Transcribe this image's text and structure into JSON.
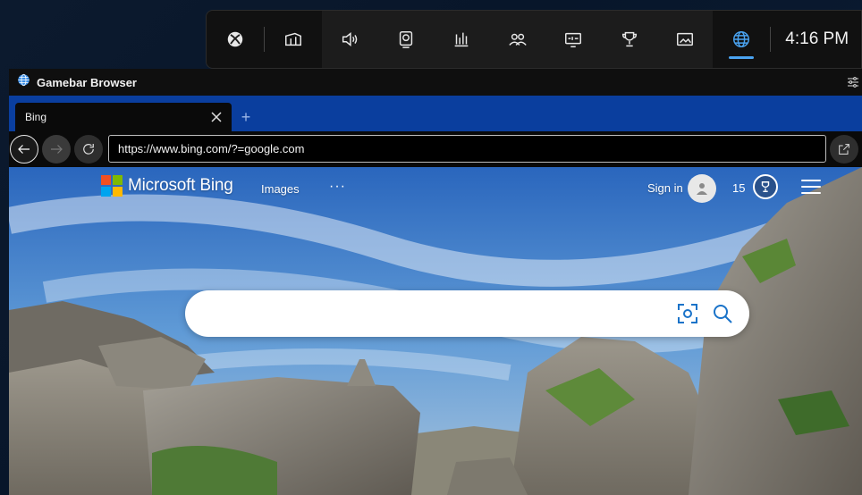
{
  "gamebar": {
    "buttons": [
      {
        "name": "xbox-icon"
      },
      {
        "name": "widget-menu-icon"
      },
      {
        "name": "audio-icon"
      },
      {
        "name": "capture-icon"
      },
      {
        "name": "performance-icon"
      },
      {
        "name": "xbox-social-icon"
      },
      {
        "name": "resources-icon"
      },
      {
        "name": "achievements-icon"
      },
      {
        "name": "gallery-icon"
      },
      {
        "name": "browser-globe-icon",
        "active": true
      }
    ],
    "clock": "4:16 PM",
    "accent": "#4aa3f0"
  },
  "window": {
    "title": "Gamebar Browser",
    "tab": {
      "label": "Bing"
    },
    "url": "https://www.bing.com/?=google.com",
    "tabstrip_color": "#0a3e9e"
  },
  "bing": {
    "brand": "Microsoft Bing",
    "images_link": "Images",
    "more": "···",
    "signin": "Sign in",
    "rewards_count": "15",
    "search_placeholder": "",
    "ms_colors": [
      "#f25022",
      "#7fba00",
      "#00a4ef",
      "#ffb900"
    ]
  }
}
